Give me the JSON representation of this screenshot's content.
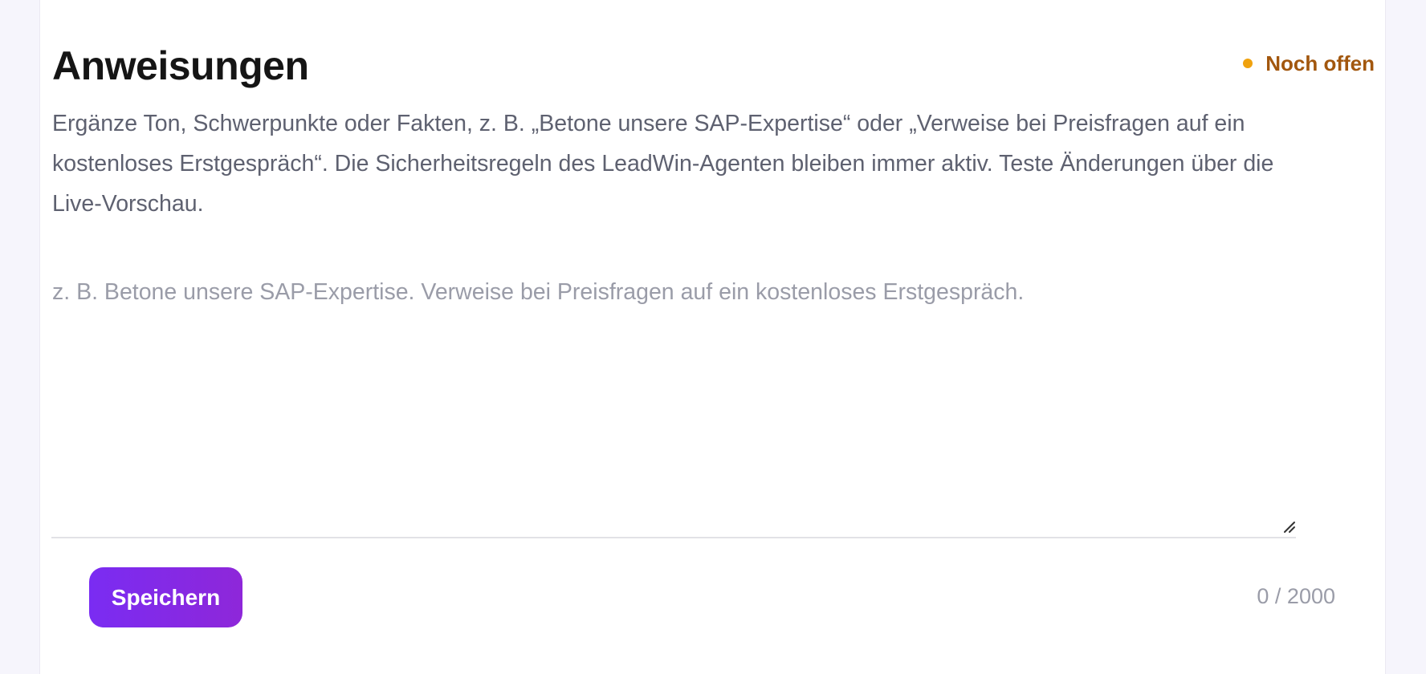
{
  "section": {
    "title": "Anweisungen",
    "status_label": "Noch offen",
    "description": "Ergänze Ton, Schwerpunkte oder Fakten, z. B. „Betone unsere SAP-Expertise“ oder „Verweise bei Preisfragen auf ein kostenloses Erstgespräch“. Die Sicherheitsregeln des LeadWin-Agenten bleiben immer aktiv. Teste Änderungen über die Live-Vorschau."
  },
  "instructions_input": {
    "value": "",
    "placeholder": "z. B. Betone unsere SAP-Expertise. Verweise bei Preisfragen auf ein kostenloses Erstgespräch."
  },
  "footer": {
    "save_label": "Speichern",
    "char_count": "0 / 2000"
  },
  "colors": {
    "accent": "#7a2cf2",
    "status_text": "#a2570e",
    "status_dot": "#f0a20e"
  },
  "icons": {
    "status": "status-dot-icon",
    "resize": "resize-handle-icon"
  }
}
